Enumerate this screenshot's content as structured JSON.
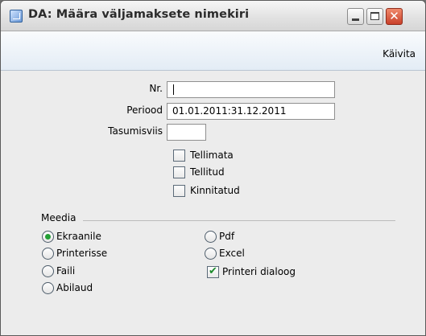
{
  "window": {
    "title": "DA: Määra väljamaksete nimekiri",
    "close_glyph": "✕"
  },
  "toolbar": {
    "run_label": "Käivita"
  },
  "form": {
    "nr_label": "Nr.",
    "nr_value": "",
    "period_label": "Periood",
    "period_value": "01.01.2011:31.12.2011",
    "payment_method_label": "Tasumisviis",
    "payment_method_value": ""
  },
  "checkboxes": [
    {
      "label": "Tellimata",
      "checked": false
    },
    {
      "label": "Tellitud",
      "checked": false
    },
    {
      "label": "Kinnitatud",
      "checked": false
    }
  ],
  "media": {
    "title": "Meedia",
    "options": [
      {
        "label": "Ekraanile",
        "selected": true
      },
      {
        "label": "Printerisse",
        "selected": false
      },
      {
        "label": "Faili",
        "selected": false
      },
      {
        "label": "Abilaud",
        "selected": false
      },
      {
        "label": "Pdf",
        "selected": false
      },
      {
        "label": "Excel",
        "selected": false
      }
    ],
    "printer_dialog_label": "Printeri dialoog",
    "printer_dialog_checked": true,
    "tick_glyph": "✔"
  }
}
